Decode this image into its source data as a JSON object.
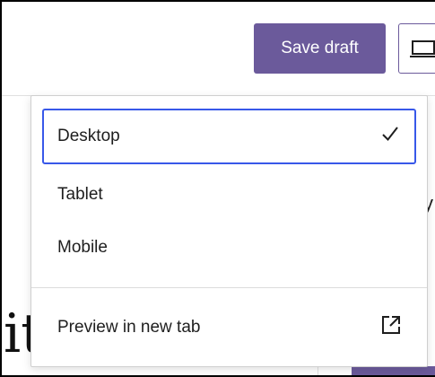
{
  "toolbar": {
    "save_draft_label": "Save draft",
    "preview_toggle_icon": "desktop-icon"
  },
  "preview_menu": {
    "items": [
      {
        "label": "Desktop",
        "selected": true,
        "icon": "check-icon"
      },
      {
        "label": "Tablet",
        "selected": false
      },
      {
        "label": "Mobile",
        "selected": false
      }
    ],
    "preview_new_tab_label": "Preview in new tab",
    "preview_new_tab_icon": "external-link-icon"
  },
  "background": {
    "heading_fragment": "ita",
    "side_fragment": "y"
  },
  "colors": {
    "accent": "#6b5a9b",
    "focus": "#3858e9"
  }
}
